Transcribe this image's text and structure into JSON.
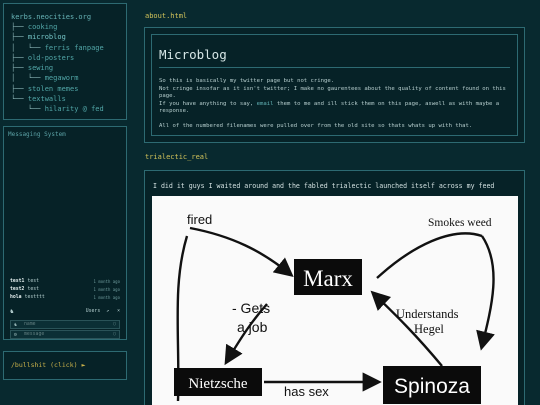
{
  "tree": {
    "site": "kerbs.neocities.org",
    "items": [
      {
        "prefix": "├── ",
        "label": "cooking",
        "highlight": false
      },
      {
        "prefix": "├── ",
        "label": "microblog",
        "highlight": true
      },
      {
        "prefix": "│   └── ",
        "label": "ferris fanpage",
        "highlight": false
      },
      {
        "prefix": "├── ",
        "label": "old-posters",
        "highlight": false
      },
      {
        "prefix": "├── ",
        "label": "sewing",
        "highlight": false
      },
      {
        "prefix": "│   └── ",
        "label": "megaworm",
        "highlight": false
      },
      {
        "prefix": "├── ",
        "label": "stolen memes",
        "highlight": false
      },
      {
        "prefix": "└── ",
        "label": "textwalls",
        "highlight": false
      },
      {
        "prefix": "    └── ",
        "label": "hilarity @ fed",
        "highlight": false
      }
    ]
  },
  "messaging": {
    "title": "Messaging System",
    "messages": [
      {
        "user": "test1",
        "text": "test",
        "time": "1 month ago"
      },
      {
        "user": "test2",
        "text": "test",
        "time": "1 month ago"
      },
      {
        "user": "hola",
        "text": "testttt",
        "time": "1 month ago"
      }
    ],
    "toolbar_label": "Users",
    "name_placeholder": "name",
    "message_placeholder": "message"
  },
  "bullshit": {
    "label": "/bullshit (click) ►"
  },
  "post1": {
    "filename": "about.html",
    "title": "Microblog",
    "p1a": "So this is basically my twitter page but not cringe.",
    "p1b": "Not cringe insofar as it isn't twitter; I make no gaurentees about the quality of content found on this page.",
    "p1c_pre": "If you have anything to say, ",
    "p1c_link": "email",
    "p1c_post": " them to me and ill stick them on this page, aswell as with maybe a response.",
    "p2": "All of the numbered filenames were pulled over from the old site so thats whats up with that."
  },
  "post2": {
    "filename": "trialectic_real",
    "caption": "I did it guys I waited around and the fabled trialectic launched itself across my feed",
    "meme": {
      "fired": "fired",
      "smokes": "Smokes weed",
      "marx": "Marx",
      "gets1": "- Gets",
      "gets2": "a job",
      "understands1": "Understands",
      "understands2": "Hegel",
      "nietzsche": "Nietzsche",
      "hassex": "has  sex",
      "spinoza": "Spinoza"
    }
  }
}
